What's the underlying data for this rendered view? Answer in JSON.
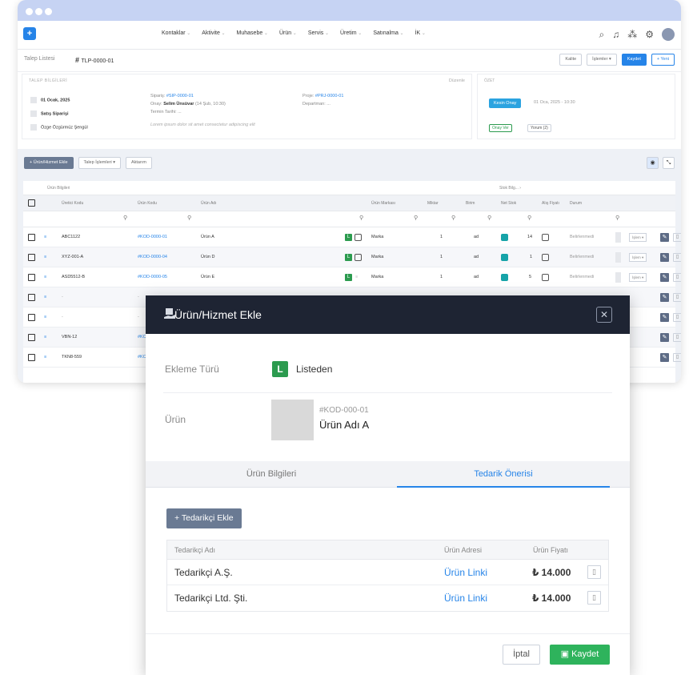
{
  "nav": {
    "logo": "+",
    "menu": [
      "Kontaklar",
      "Aktivite",
      "Muhasebe",
      "Ürün",
      "Servis",
      "Üretim",
      "Satınalma",
      "İK"
    ]
  },
  "breadcrumb": {
    "parent": "Talep Listesi",
    "current": "TLP-0000-01"
  },
  "top_buttons": {
    "kalite": "Kalite",
    "islemler": "İşlemler ▾",
    "kaydet": "Kaydet",
    "yeni": "+ Yeni"
  },
  "info": {
    "header": "TALEP BİLGİLERİ",
    "edit": "Düzenle",
    "date": "01 Ocak, 2025",
    "type": "Satış Siparişi",
    "person": "Özge Özgürmüz Şengül",
    "siparis_label": "Sipariş:",
    "siparis": "#SIP-0000-01",
    "onay_label": "Onay:",
    "onay": "Selim Ünsüvar",
    "onay_date": "(14 Şub, 10:30)",
    "termin": "Termin Tarihi: ...",
    "note": "Lorem ipsum dolor sit amet consectetur adipiscing elit",
    "proje_label": "Proje:",
    "proje": "#PRJ-0000-01",
    "departman": "Departman: ..."
  },
  "ozet": {
    "header": "ÖZET",
    "status": "Kesin Onay",
    "status_date": "01 Oca, 2025 - 10:30",
    "onay_btn": "Onay Ver",
    "yorum_btn": "Yorum (2)"
  },
  "toolbar": {
    "add": "+ Ürün/Hizmet Ekle",
    "talep": "Talep İşlemleri ▾",
    "aktarim": "Aktarım"
  },
  "table": {
    "group": "Ürün Bilgileri",
    "stok_group": "Stok Bilg... ›",
    "headers": [
      "Üretici Kodu",
      "Ürün Kodu",
      "Ürün Adı",
      "Ürün Markası",
      "Miktar",
      "Birim",
      "Net Stok",
      "Alış Fiyatı",
      "Durum"
    ],
    "rows": [
      {
        "uretici": "ABC1122",
        "kod": "#KOD-0000-01",
        "ad": "Ürün A",
        "marka": "Marka",
        "miktar": "1",
        "birim": "ad",
        "stok": "14",
        "durum": "Belirlenmedi",
        "islem": "İşlem ▾"
      },
      {
        "uretici": "XYZ-001-A",
        "kod": "#KOD-0000-04",
        "ad": "Ürün D",
        "marka": "Marka",
        "miktar": "1",
        "birim": "ad",
        "stok": "1",
        "durum": "Belirlenmedi",
        "islem": "İşlem ▾"
      },
      {
        "uretici": "ASD5512-B",
        "kod": "#KOD-0000-05",
        "ad": "Ürün E",
        "marka": "Marka",
        "miktar": "1",
        "birim": "ad",
        "stok": "5",
        "durum": "Belirlenmedi",
        "islem": "İşlem ▾"
      },
      {
        "uretici": "-",
        "kod": "-"
      },
      {
        "uretici": "-",
        "kod": "-"
      },
      {
        "uretici": "VBN-12",
        "kod": "#KOD-000"
      },
      {
        "uretici": "TKN8-559",
        "kod": "#KOD-000"
      }
    ]
  },
  "modal": {
    "title": "Ürün/Hizmet Ekle",
    "ekleme_label": "Ekleme Türü",
    "ekleme_badge": "L",
    "ekleme_value": "Listeden",
    "urun_label": "Ürün",
    "urun_code": "#KOD-000-01",
    "urun_name": "Ürün Adı A",
    "tab1": "Ürün Bilgileri",
    "tab2": "Tedarik Önerisi",
    "add_supplier": "+ Tedarikçi Ekle",
    "cols": {
      "ad": "Tedarikçi Adı",
      "adres": "Ürün Adresi",
      "fiyat": "Ürün Fiyatı"
    },
    "suppliers": [
      {
        "name": "Tedarikçi A.Ş.",
        "link": "Ürün Linki",
        "price": "₺ 14.000"
      },
      {
        "name": "Tedarikçi Ltd. Şti.",
        "link": "Ürün Linki",
        "price": "₺ 14.000"
      }
    ],
    "cancel": "İptal",
    "save": "Kaydet"
  }
}
